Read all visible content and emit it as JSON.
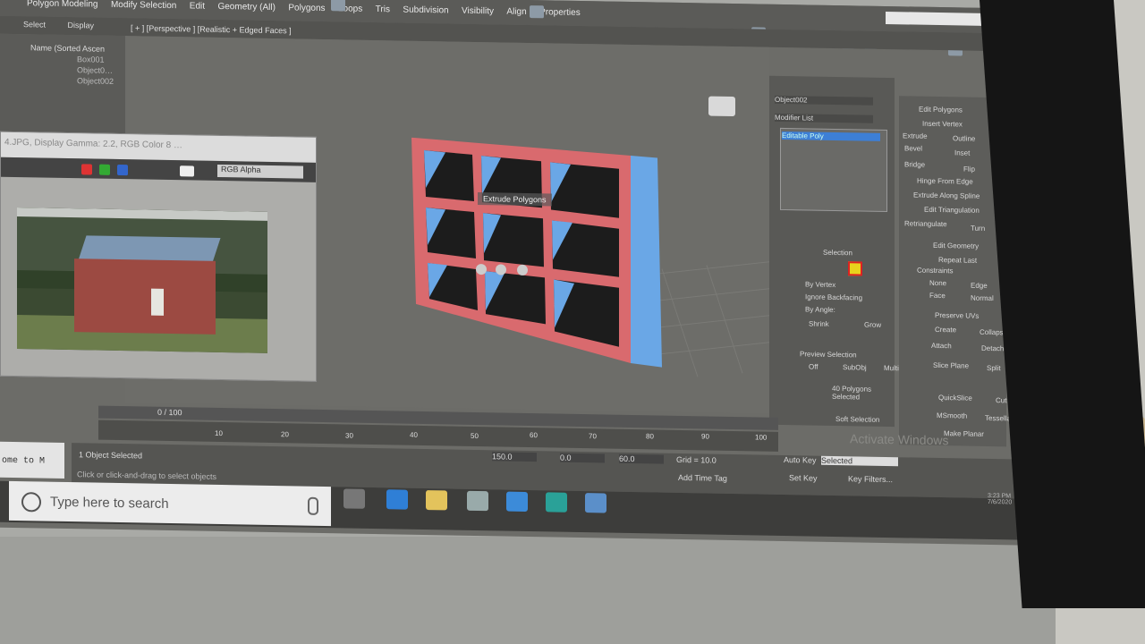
{
  "menubar": {
    "items": [
      "Polygon Modeling",
      "Modify Selection",
      "Edit",
      "Geometry (All)",
      "Polygons",
      "Loops",
      "Tris",
      "Subdivision",
      "Visibility",
      "Align",
      "Properties"
    ]
  },
  "ribbon": {
    "items": [
      "Select",
      "Display"
    ]
  },
  "viewport": {
    "label": "[ + ] [Perspective ] [Realistic + Edged Faces ]",
    "caddy_label": "Extrude Polygons"
  },
  "scene": {
    "header": "Name (Sorted Ascen",
    "items": [
      "Box001",
      "Object0…",
      "Object002"
    ]
  },
  "frame_window": {
    "title": "4.JPG, Display Gamma: 2.2, RGB Color 8 …",
    "channel": "RGB Alpha"
  },
  "modify": {
    "object_name": "Object002",
    "modifier_list": "Modifier List",
    "stack_item": "Editable Poly"
  },
  "selection": {
    "header": "Selection",
    "by_vertex": "By Vertex",
    "ignore_backfacing": "Ignore Backfacing",
    "by_angle": "By Angle:",
    "shrink": "Shrink",
    "grow": "Grow",
    "preview": "Preview Selection",
    "off": "Off",
    "subobj": "SubObj",
    "multi": "Multi",
    "count": "40 Polygons Selected",
    "soft": "Soft Selection"
  },
  "edit_polygons": {
    "header": "Edit Polygons",
    "insert_vertex": "Insert Vertex",
    "extrude": "Extrude",
    "outline": "Outline",
    "bevel": "Bevel",
    "inset": "Inset",
    "bridge": "Bridge",
    "flip": "Flip",
    "hinge": "Hinge From Edge",
    "extrude_spline": "Extrude Along Spline",
    "edit_tri": "Edit Triangulation",
    "retriangulate": "Retriangulate",
    "turn": "Turn"
  },
  "edit_geometry": {
    "header": "Edit Geometry",
    "repeat": "Repeat Last",
    "constraints": "Constraints",
    "none": "None",
    "edge": "Edge",
    "face": "Face",
    "normal": "Normal",
    "preserve": "Preserve UVs",
    "create": "Create",
    "collapse": "Collapse",
    "attach": "Attach",
    "detach": "Detach",
    "slice_plane": "Slice Plane",
    "split": "Split",
    "quickslice": "QuickSlice",
    "cut": "Cut",
    "msmooth": "MSmooth",
    "tessellate": "Tessellate",
    "make_planar": "Make Planar"
  },
  "timeline": {
    "frame": "0 / 100",
    "ticks": [
      "10",
      "20",
      "30",
      "40",
      "50",
      "60",
      "70",
      "80",
      "90",
      "100"
    ]
  },
  "status": {
    "selected": "1 Object Selected",
    "hint": "Click or click-and-drag to select objects",
    "x": "150.0",
    "y": "0.0",
    "z": "60.0",
    "grid": "Grid = 10.0",
    "add_time_tag": "Add Time Tag",
    "auto_key": "Auto Key",
    "set_key": "Set Key",
    "selected_dd": "Selected",
    "key_filters": "Key Filters..."
  },
  "ghost_text": "ome to M",
  "taskbar": {
    "search_placeholder": "Type here to search",
    "time": "3:23 PM",
    "date": "7/6/2020"
  },
  "watermark": "Activate Windows",
  "colors": {
    "model_frame": "#d96a6e",
    "model_side": "#6aa7e6",
    "selection": "#e8d21c"
  }
}
